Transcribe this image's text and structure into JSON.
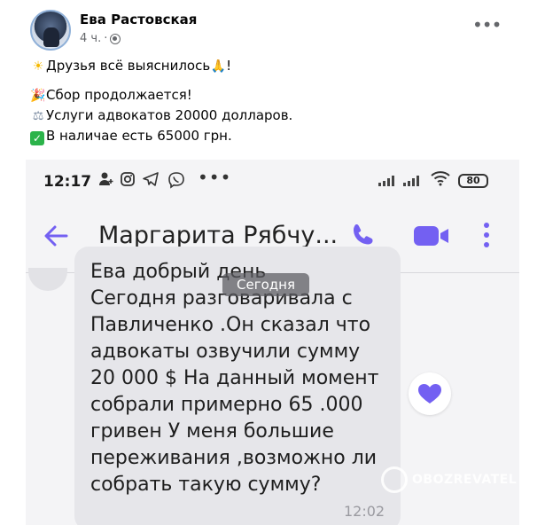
{
  "post": {
    "author": "Ева Растовская",
    "time": "4 ч.",
    "lines": [
      {
        "emoji": "☀",
        "text": "Друзья всё выяснилось",
        "emoji_after": "🙏",
        "tail": "!"
      },
      {
        "emoji": "🎉",
        "text": "Сбор продолжается!"
      },
      {
        "emoji": "⚖",
        "text": "Услуги адвокатов 20000 долларов."
      },
      {
        "emoji": "✓",
        "text": "В наличае есть 65000 грн."
      }
    ],
    "icons": {
      "more": "more-icon",
      "privacy": "globe-icon"
    }
  },
  "phone": {
    "status": {
      "time": "12:17",
      "battery": "80"
    },
    "chat_header": {
      "contact_name": "Маргарита Рябчу..."
    },
    "date_chip": "Сегодня",
    "message": {
      "lines": [
        "Ева добрый день",
        "Сегодня разговаривала с",
        "Павличенко .Он сказал что",
        "адвокаты озвучили сумму",
        "20 000 $ На данный момент",
        "собрали примерно 65 .000",
        "гривен У меня большие",
        "переживания ,возможно ли",
        "собрать такую сумму?"
      ],
      "time": "12:02"
    },
    "watermark": "OBOZREVATEL",
    "colors": {
      "accent": "#7360f2",
      "underline": "#d0181e",
      "bubble": "#e6e6ea"
    }
  }
}
